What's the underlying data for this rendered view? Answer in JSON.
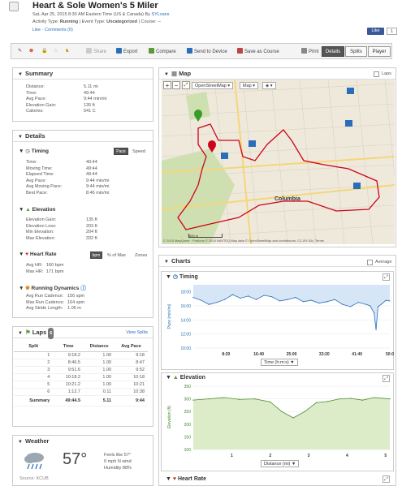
{
  "header": {
    "title": "Heart & Sole Women's 5 Miler",
    "date_line_prefix": "Sat, Apr 25, 2015 8:30 AM Eastern Time (US & Canada) By ",
    "author": "SYLvans",
    "activity_type_label": "Activity Type: ",
    "activity_type": "Running",
    "event_type_label": " | Event Type: ",
    "event_type": "Uncategorized",
    "course_label": " | Course: --",
    "like_link": "Like",
    "comments_link": "Comments (0)",
    "fb_like": "Like",
    "fb_count": "1"
  },
  "toolbar": {
    "share": "Share",
    "export": "Export",
    "compare": "Compare",
    "send": "Send to Device",
    "save_course": "Save as Course",
    "print": "Print",
    "views": [
      "Details",
      "Splits",
      "Player"
    ]
  },
  "summary": {
    "title": "Summary",
    "rows": [
      {
        "label": "Distance:",
        "value": "5.11 mi"
      },
      {
        "label": "Time:",
        "value": "49:44"
      },
      {
        "label": "Avg Pace:",
        "value": "9:44 min/mi"
      },
      {
        "label": "Elevation Gain:",
        "value": "135 ft"
      },
      {
        "label": "Calories:",
        "value": "541 C"
      }
    ]
  },
  "details": {
    "title": "Details",
    "timing": {
      "title": "Timing",
      "toggle_pace": "Pace",
      "toggle_speed": "Speed",
      "rows": [
        {
          "label": "Time:",
          "value": "49:44"
        },
        {
          "label": "Moving Time:",
          "value": "49:44"
        },
        {
          "label": "Elapsed Time:",
          "value": "49:44"
        },
        {
          "label": "Avg Pace:",
          "value": "9:44 min/mi"
        },
        {
          "label": "Avg Moving Pace:",
          "value": "9:44 min/mi"
        },
        {
          "label": "Best Pace:",
          "value": "8:46 min/mi"
        }
      ]
    },
    "elevation": {
      "title": "Elevation",
      "rows": [
        {
          "label": "Elevation Gain:",
          "value": "135 ft"
        },
        {
          "label": "Elevation Loss:",
          "value": "203 ft"
        },
        {
          "label": "Min Elevation:",
          "value": "204 ft"
        },
        {
          "label": "Max Elevation:",
          "value": "332 ft"
        }
      ]
    },
    "heart_rate": {
      "title": "Heart Rate",
      "toggle_bpm": "bpm",
      "toggle_max": "% of Max",
      "toggle_zones": "Zones",
      "rows": [
        {
          "label": "Avg HR:",
          "value": "160 bpm"
        },
        {
          "label": "Max HR:",
          "value": "171 bpm"
        }
      ]
    },
    "running_dynamics": {
      "title": "Running Dynamics",
      "rows": [
        {
          "label": "Avg Run Cadence:",
          "value": "156 spm"
        },
        {
          "label": "Max Run Cadence:",
          "value": "164 spm"
        },
        {
          "label": "Avg Stride Length:",
          "value": "1.06 m"
        }
      ]
    }
  },
  "laps": {
    "title": "Laps",
    "count": "6",
    "view_splits": "View Splits",
    "columns": [
      "Split",
      "Time",
      "Distance",
      "Avg Pace"
    ],
    "rows": [
      [
        "1",
        "9:18.2",
        "1.00",
        "9:18"
      ],
      [
        "2",
        "8:46.5",
        "1.00",
        "8:47"
      ],
      [
        "3",
        "9:51.6",
        "1.00",
        "9:52"
      ],
      [
        "4",
        "10:18.2",
        "1.00",
        "10:18"
      ],
      [
        "5",
        "10:21.2",
        "1.00",
        "10:21"
      ],
      [
        "6",
        "1:12.7",
        "0.11",
        "10:38"
      ]
    ],
    "summary": [
      "Summary",
      "49:44.5",
      "5.11",
      "9:44"
    ]
  },
  "weather": {
    "title": "Weather",
    "temp": "57°",
    "feels_like": "Feels like 57°",
    "wind": "0 mph N wind",
    "humidity": "Humidity 88%",
    "source": "Source: KCUB",
    "icon": "rain-cloud-icon"
  },
  "map": {
    "title": "Map",
    "laps_label": "Laps",
    "layer_select": "OpenStreetMap",
    "type_select": "Map",
    "city_label": "Columbia",
    "scale_top": "500 m",
    "scale_bottom": "2000 ft",
    "attribution": "© 2015 MapQuest · Portions © 2015 NAVTEQ Map data © OpenStreetMap and contributors, CC-BY-SA | Terms"
  },
  "charts": {
    "title": "Charts",
    "average_label": "Average",
    "timing": {
      "title": "Timing",
      "ylabel": "Pace (min/mi)",
      "xaxis_select": "Time (h:m:s)"
    },
    "elevation": {
      "title": "Elevation",
      "ylabel": "Elevation (ft)",
      "xaxis_select": "Distance (mi)"
    },
    "heart_rate": {
      "title": "Heart Rate"
    }
  },
  "chart_data": [
    {
      "type": "line",
      "title": "Timing",
      "ylabel": "Pace (min/mi)",
      "xlabel": "Time (h:m:s)",
      "y_ticks": [
        "10:00",
        "12:00",
        "14:00",
        "16:00",
        "18:00"
      ],
      "x_ticks": [
        "8:20",
        "16:40",
        "25:00",
        "33:20",
        "41:40",
        "50:0"
      ],
      "ylim_minutes": [
        10,
        19
      ],
      "xlim_minutes": [
        0,
        50
      ],
      "x_minutes": [
        0,
        2,
        4,
        6,
        8,
        10,
        12,
        14,
        16,
        18,
        20,
        22,
        24,
        26,
        28,
        30,
        32,
        34,
        36,
        38,
        40,
        42,
        44,
        45,
        46,
        46.5,
        47,
        48,
        49,
        50
      ],
      "y_minutes": [
        17.2,
        16.8,
        16.2,
        16.5,
        16.9,
        17.6,
        17.1,
        17.4,
        16.9,
        17.5,
        17.3,
        16.7,
        16.9,
        17.2,
        16.6,
        16.8,
        16.4,
        16.6,
        16.9,
        16.2,
        15.9,
        16.5,
        16.2,
        16.0,
        15.0,
        12.6,
        15.9,
        16.3,
        16.8,
        16.7
      ]
    },
    {
      "type": "area",
      "title": "Elevation",
      "ylabel": "Elevation (ft)",
      "xlabel": "Distance (mi)",
      "y_ticks": [
        100,
        150,
        200,
        250,
        300,
        350
      ],
      "x_ticks": [
        1,
        2,
        3,
        4,
        5
      ],
      "ylim": [
        100,
        350
      ],
      "xlim": [
        0,
        5.11
      ],
      "x": [
        0,
        0.4,
        0.8,
        1.2,
        1.6,
        2.0,
        2.3,
        2.6,
        2.9,
        3.2,
        3.5,
        3.8,
        4.1,
        4.4,
        4.7,
        5.11
      ],
      "y": [
        295,
        300,
        305,
        298,
        300,
        288,
        250,
        225,
        250,
        285,
        290,
        300,
        302,
        295,
        305,
        300
      ]
    }
  ]
}
